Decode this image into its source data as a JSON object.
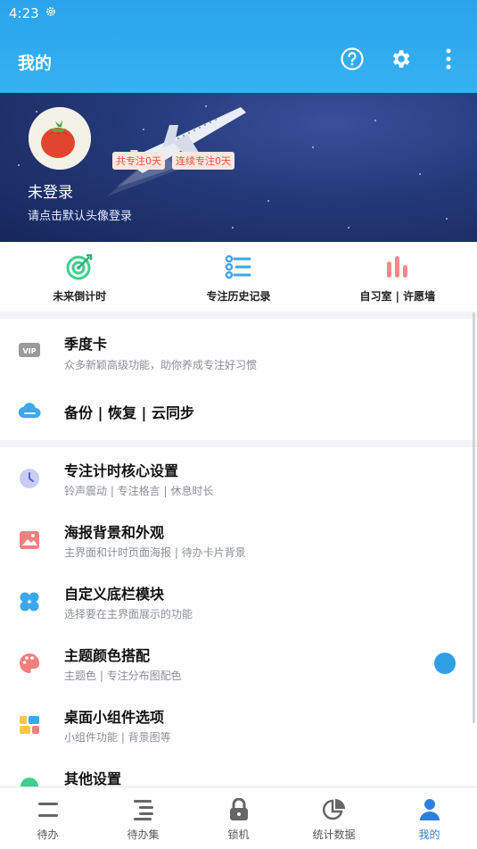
{
  "status": {
    "time": "4:23"
  },
  "appbar": {
    "title": "我的"
  },
  "profile": {
    "badge_total": "共专注0天",
    "badge_streak": "连续专注0天",
    "login_title": "未登录",
    "login_hint": "请点击默认头像登录"
  },
  "quick_actions": [
    {
      "label": "未来倒计时",
      "icon": "target-icon"
    },
    {
      "label": "专注历史记录",
      "icon": "history-list-icon"
    },
    {
      "label": "自习室 | 许愿墙",
      "icon": "bar-chart-icon"
    }
  ],
  "menu": {
    "vip": {
      "title": "季度卡",
      "subtitle": "众多新颖高级功能，助你养成专注好习惯",
      "icon_text": "VIP"
    },
    "backup": {
      "title": "备份 | 恢复 | 云同步"
    },
    "focus": {
      "title": "专注计时核心设置",
      "subtitle": "铃声震动 | 专注格言 | 休息时长"
    },
    "poster": {
      "title": "海报背景和外观",
      "subtitle": "主界面和计时页面海报 | 待办卡片背景"
    },
    "bottombar": {
      "title": "自定义底栏模块",
      "subtitle": "选择要在主界面展示的功能"
    },
    "theme": {
      "title": "主题颜色搭配",
      "subtitle": "主题色 | 专注分布图配色"
    },
    "widget": {
      "title": "桌面小组件选项",
      "subtitle": "小组件功能 | 背景图等"
    },
    "other": {
      "title": "其他设置"
    }
  },
  "bottom_nav": [
    {
      "label": "待办"
    },
    {
      "label": "待办集"
    },
    {
      "label": "锁机"
    },
    {
      "label": "统计数据"
    },
    {
      "label": "我的"
    }
  ],
  "colors": {
    "primary": "#2aa3ea",
    "accent": "#2f7fd6",
    "banner": "#243978"
  }
}
